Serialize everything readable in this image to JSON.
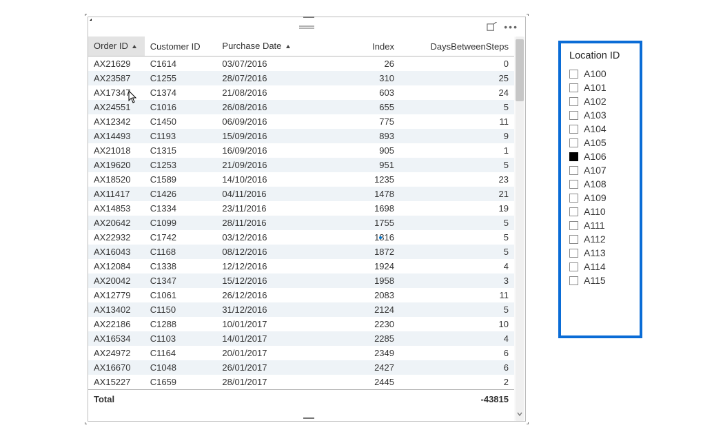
{
  "table": {
    "headers": {
      "order_id": "Order ID",
      "customer_id": "Customer ID",
      "purchase_date": "Purchase Date",
      "index": "Index",
      "days_between": "DaysBetweenSteps"
    },
    "rows": [
      {
        "order_id": "AX21629",
        "customer_id": "C1614",
        "purchase_date": "03/07/2016",
        "index": "26",
        "days_between": "0"
      },
      {
        "order_id": "AX23587",
        "customer_id": "C1255",
        "purchase_date": "28/07/2016",
        "index": "310",
        "days_between": "25"
      },
      {
        "order_id": "AX17347",
        "customer_id": "C1374",
        "purchase_date": "21/08/2016",
        "index": "603",
        "days_between": "24"
      },
      {
        "order_id": "AX24551",
        "customer_id": "C1016",
        "purchase_date": "26/08/2016",
        "index": "655",
        "days_between": "5"
      },
      {
        "order_id": "AX12342",
        "customer_id": "C1450",
        "purchase_date": "06/09/2016",
        "index": "775",
        "days_between": "11"
      },
      {
        "order_id": "AX14493",
        "customer_id": "C1193",
        "purchase_date": "15/09/2016",
        "index": "893",
        "days_between": "9"
      },
      {
        "order_id": "AX21018",
        "customer_id": "C1315",
        "purchase_date": "16/09/2016",
        "index": "905",
        "days_between": "1"
      },
      {
        "order_id": "AX19620",
        "customer_id": "C1253",
        "purchase_date": "21/09/2016",
        "index": "951",
        "days_between": "5"
      },
      {
        "order_id": "AX18520",
        "customer_id": "C1589",
        "purchase_date": "14/10/2016",
        "index": "1235",
        "days_between": "23"
      },
      {
        "order_id": "AX11417",
        "customer_id": "C1426",
        "purchase_date": "04/11/2016",
        "index": "1478",
        "days_between": "21"
      },
      {
        "order_id": "AX14853",
        "customer_id": "C1334",
        "purchase_date": "23/11/2016",
        "index": "1698",
        "days_between": "19"
      },
      {
        "order_id": "AX20642",
        "customer_id": "C1099",
        "purchase_date": "28/11/2016",
        "index": "1755",
        "days_between": "5"
      },
      {
        "order_id": "AX22932",
        "customer_id": "C1742",
        "purchase_date": "03/12/2016",
        "index": "1816",
        "days_between": "5"
      },
      {
        "order_id": "AX16043",
        "customer_id": "C1168",
        "purchase_date": "08/12/2016",
        "index": "1872",
        "days_between": "5"
      },
      {
        "order_id": "AX12084",
        "customer_id": "C1338",
        "purchase_date": "12/12/2016",
        "index": "1924",
        "days_between": "4"
      },
      {
        "order_id": "AX20042",
        "customer_id": "C1347",
        "purchase_date": "15/12/2016",
        "index": "1958",
        "days_between": "3"
      },
      {
        "order_id": "AX12779",
        "customer_id": "C1061",
        "purchase_date": "26/12/2016",
        "index": "2083",
        "days_between": "11"
      },
      {
        "order_id": "AX13402",
        "customer_id": "C1150",
        "purchase_date": "31/12/2016",
        "index": "2124",
        "days_between": "5"
      },
      {
        "order_id": "AX22186",
        "customer_id": "C1288",
        "purchase_date": "10/01/2017",
        "index": "2230",
        "days_between": "10"
      },
      {
        "order_id": "AX16534",
        "customer_id": "C1103",
        "purchase_date": "14/01/2017",
        "index": "2285",
        "days_between": "4"
      },
      {
        "order_id": "AX24972",
        "customer_id": "C1164",
        "purchase_date": "20/01/2017",
        "index": "2349",
        "days_between": "6"
      },
      {
        "order_id": "AX16670",
        "customer_id": "C1048",
        "purchase_date": "26/01/2017",
        "index": "2427",
        "days_between": "6"
      },
      {
        "order_id": "AX15227",
        "customer_id": "C1659",
        "purchase_date": "28/01/2017",
        "index": "2445",
        "days_between": "2"
      }
    ],
    "total_label": "Total",
    "total_value": "-43815"
  },
  "slicer": {
    "title": "Location ID",
    "items": [
      {
        "label": "A100",
        "checked": false
      },
      {
        "label": "A101",
        "checked": false
      },
      {
        "label": "A102",
        "checked": false
      },
      {
        "label": "A103",
        "checked": false
      },
      {
        "label": "A104",
        "checked": false
      },
      {
        "label": "A105",
        "checked": false
      },
      {
        "label": "A106",
        "checked": true
      },
      {
        "label": "A107",
        "checked": false
      },
      {
        "label": "A108",
        "checked": false
      },
      {
        "label": "A109",
        "checked": false
      },
      {
        "label": "A110",
        "checked": false
      },
      {
        "label": "A111",
        "checked": false
      },
      {
        "label": "A112",
        "checked": false
      },
      {
        "label": "A113",
        "checked": false
      },
      {
        "label": "A114",
        "checked": false
      },
      {
        "label": "A115",
        "checked": false
      }
    ]
  }
}
